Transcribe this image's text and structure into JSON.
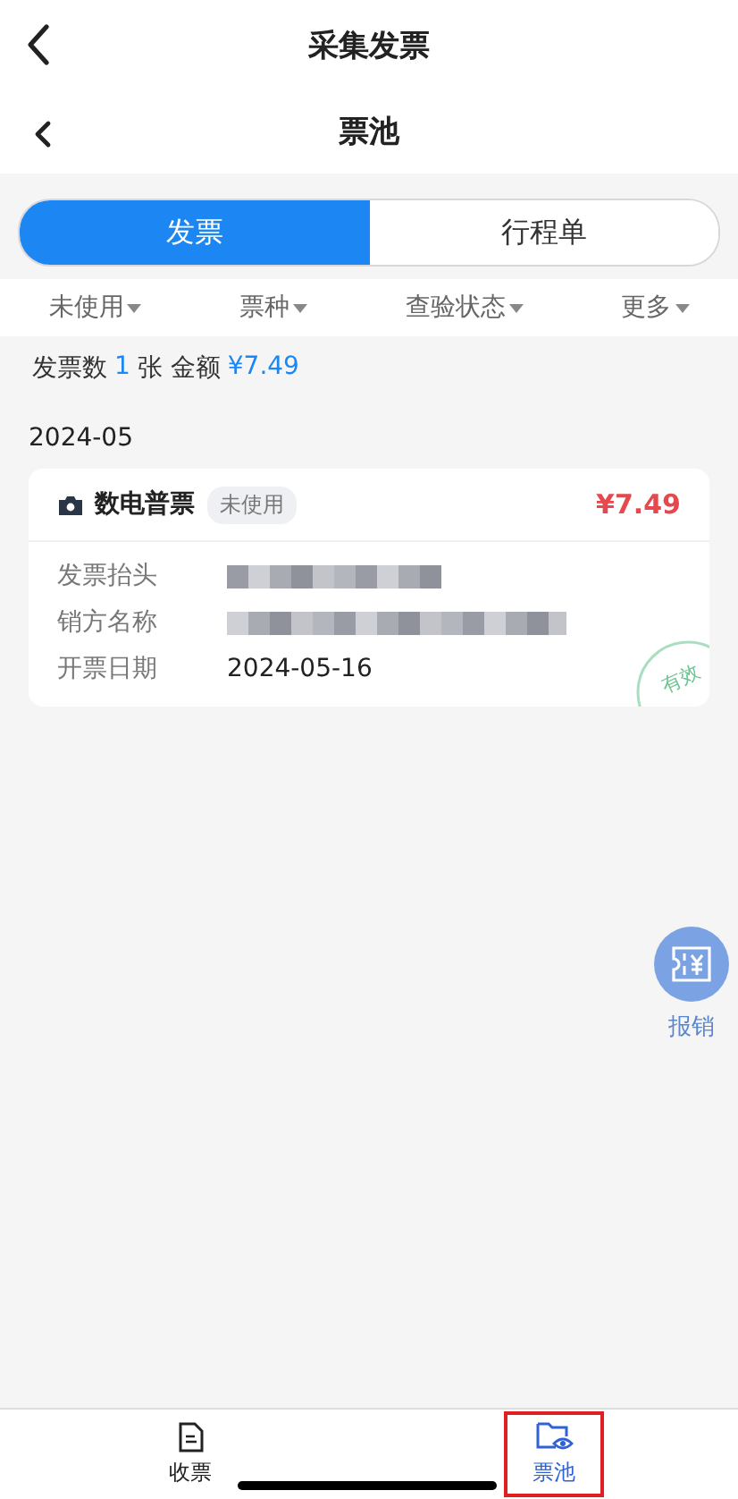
{
  "outer_header": {
    "title": "采集发票"
  },
  "header": {
    "title": "票池"
  },
  "segments": [
    {
      "label": "发票",
      "selected": true
    },
    {
      "label": "行程单",
      "selected": false
    }
  ],
  "filters": [
    "未使用",
    "票种",
    "查验状态",
    "更多"
  ],
  "summary": {
    "prefix": "发票数",
    "count": "1",
    "unit": "张 金额",
    "amount": "¥7.49"
  },
  "groups": [
    {
      "month": "2024-05",
      "invoices": [
        {
          "type": "数电普票",
          "status": "未使用",
          "amount": "¥7.49",
          "valid": true,
          "valid_label": "有效",
          "fields": [
            {
              "label": "发票抬头",
              "redacted": true
            },
            {
              "label": "销方名称",
              "redacted": true
            },
            {
              "label": "开票日期",
              "value": "2024-05-16"
            }
          ]
        }
      ]
    }
  ],
  "float_action": {
    "label": "报销"
  },
  "tabbar": [
    {
      "label": "收票",
      "selected": false,
      "highlighted": false
    },
    {
      "label": "票池",
      "selected": true,
      "highlighted": true
    }
  ]
}
